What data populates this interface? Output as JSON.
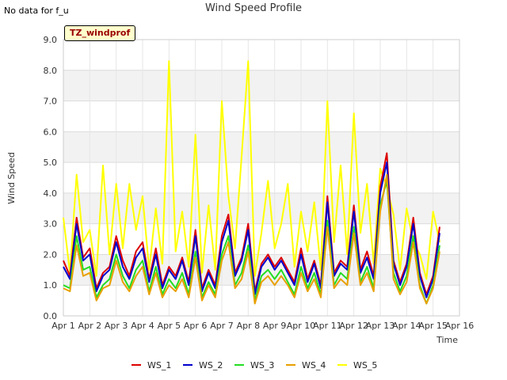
{
  "no_data_text": "No data for f_u",
  "site_tag": "TZ_windprof",
  "chart_data": {
    "type": "line",
    "title": "Wind Speed Profile",
    "xlabel": "Time",
    "ylabel": "Wind Speed",
    "xlim": [
      1,
      16
    ],
    "ylim": [
      0,
      9
    ],
    "x_ticks": [
      1,
      2,
      3,
      4,
      5,
      6,
      7,
      8,
      9,
      10,
      11,
      12,
      13,
      14,
      15,
      16
    ],
    "x_tick_labels": [
      "Apr 1",
      "Apr 2",
      "Apr 3",
      "Apr 4",
      "Apr 5",
      "Apr 6",
      "Apr 7",
      "Apr 8",
      "Apr 9",
      "Apr 10",
      "Apr 11",
      "Apr 12",
      "Apr 13",
      "Apr 14",
      "Apr 15",
      "Apr 16"
    ],
    "y_ticks": [
      0,
      1,
      2,
      3,
      4,
      5,
      6,
      7,
      8,
      9
    ],
    "y_tick_labels": [
      "0.0",
      "1.0",
      "2.0",
      "3.0",
      "4.0",
      "5.0",
      "6.0",
      "7.0",
      "8.0",
      "9.0"
    ],
    "grid": true,
    "legend_position": "bottom",
    "x": [
      1.0,
      1.25,
      1.5,
      1.75,
      2.0,
      2.25,
      2.5,
      2.75,
      3.0,
      3.25,
      3.5,
      3.75,
      4.0,
      4.25,
      4.5,
      4.75,
      5.0,
      5.25,
      5.5,
      5.75,
      6.0,
      6.25,
      6.5,
      6.75,
      7.0,
      7.25,
      7.5,
      7.75,
      8.0,
      8.25,
      8.5,
      8.75,
      9.0,
      9.25,
      9.5,
      9.75,
      10.0,
      10.25,
      10.5,
      10.75,
      11.0,
      11.25,
      11.5,
      11.75,
      12.0,
      12.25,
      12.5,
      12.75,
      13.0,
      13.25,
      13.5,
      13.75,
      14.0,
      14.25,
      14.5,
      14.75,
      15.0,
      15.25
    ],
    "series": [
      {
        "name": "WS_1",
        "color": "#dd0000",
        "values": [
          1.8,
          1.3,
          3.2,
          1.9,
          2.2,
          0.9,
          1.4,
          1.6,
          2.6,
          1.8,
          1.3,
          2.1,
          2.4,
          1.2,
          2.2,
          1.0,
          1.6,
          1.3,
          1.9,
          1.1,
          2.8,
          0.9,
          1.5,
          1.0,
          2.6,
          3.3,
          1.4,
          1.9,
          3.0,
          0.8,
          1.7,
          2.0,
          1.6,
          1.9,
          1.5,
          1.1,
          2.2,
          1.2,
          1.8,
          1.0,
          3.9,
          1.4,
          1.8,
          1.6,
          3.6,
          1.5,
          2.1,
          1.3,
          4.2,
          5.3,
          1.8,
          1.1,
          1.7,
          3.2,
          1.4,
          0.7,
          1.3,
          2.9
        ]
      },
      {
        "name": "WS_2",
        "color": "#0000cc",
        "values": [
          1.6,
          1.2,
          3.0,
          1.8,
          2.0,
          0.8,
          1.3,
          1.5,
          2.4,
          1.6,
          1.2,
          1.9,
          2.2,
          1.1,
          2.0,
          0.9,
          1.5,
          1.2,
          1.8,
          1.0,
          2.6,
          0.8,
          1.4,
          0.9,
          2.4,
          3.1,
          1.3,
          1.8,
          2.8,
          0.7,
          1.6,
          1.9,
          1.5,
          1.8,
          1.4,
          1.0,
          2.0,
          1.1,
          1.7,
          0.9,
          3.7,
          1.3,
          1.7,
          1.5,
          3.4,
          1.4,
          1.9,
          1.2,
          4.0,
          5.0,
          1.7,
          1.0,
          1.6,
          3.0,
          1.3,
          0.6,
          1.2,
          2.7
        ]
      },
      {
        "name": "WS_3",
        "color": "#22dd22",
        "values": [
          1.0,
          0.9,
          2.6,
          1.5,
          1.6,
          0.6,
          1.0,
          1.2,
          2.0,
          1.3,
          0.9,
          1.5,
          1.8,
          0.8,
          1.6,
          0.7,
          1.2,
          0.9,
          1.4,
          0.7,
          2.1,
          0.6,
          1.1,
          0.7,
          2.0,
          2.6,
          1.0,
          1.4,
          2.3,
          0.5,
          1.3,
          1.5,
          1.2,
          1.5,
          1.1,
          0.7,
          1.6,
          0.9,
          1.4,
          0.7,
          3.1,
          1.0,
          1.4,
          1.2,
          2.9,
          1.1,
          1.6,
          0.9,
          3.6,
          4.4,
          1.4,
          0.8,
          1.3,
          2.6,
          1.0,
          0.4,
          1.0,
          2.3
        ]
      },
      {
        "name": "WS_4",
        "color": "#e8a000",
        "values": [
          0.9,
          0.8,
          2.3,
          1.3,
          1.4,
          0.5,
          0.9,
          1.0,
          1.8,
          1.1,
          0.8,
          1.3,
          1.6,
          0.7,
          1.4,
          0.6,
          1.0,
          0.8,
          1.2,
          0.6,
          1.9,
          0.5,
          1.0,
          0.6,
          1.8,
          2.4,
          0.9,
          1.2,
          2.1,
          0.4,
          1.1,
          1.3,
          1.0,
          1.3,
          1.0,
          0.6,
          1.4,
          0.8,
          1.2,
          0.6,
          2.9,
          0.9,
          1.2,
          1.0,
          2.7,
          1.0,
          1.4,
          0.8,
          3.4,
          4.6,
          1.2,
          0.7,
          1.1,
          2.4,
          0.9,
          0.4,
          0.9,
          2.1
        ]
      },
      {
        "name": "WS_5",
        "color": "#ffff00",
        "values": [
          3.2,
          1.4,
          4.6,
          2.4,
          2.8,
          1.3,
          4.9,
          2.0,
          4.3,
          2.2,
          4.3,
          2.8,
          3.9,
          1.5,
          3.5,
          1.7,
          8.3,
          2.1,
          3.4,
          1.6,
          5.9,
          1.4,
          3.6,
          1.5,
          7.0,
          3.9,
          2.2,
          5.2,
          8.3,
          1.3,
          2.7,
          4.4,
          2.2,
          3.0,
          4.3,
          1.6,
          3.4,
          2.1,
          3.7,
          1.5,
          7.0,
          2.4,
          4.9,
          2.0,
          6.6,
          2.7,
          4.3,
          1.7,
          4.8,
          4.2,
          3.3,
          1.5,
          3.5,
          2.4,
          2.0,
          1.2,
          3.4,
          2.4
        ]
      }
    ]
  }
}
